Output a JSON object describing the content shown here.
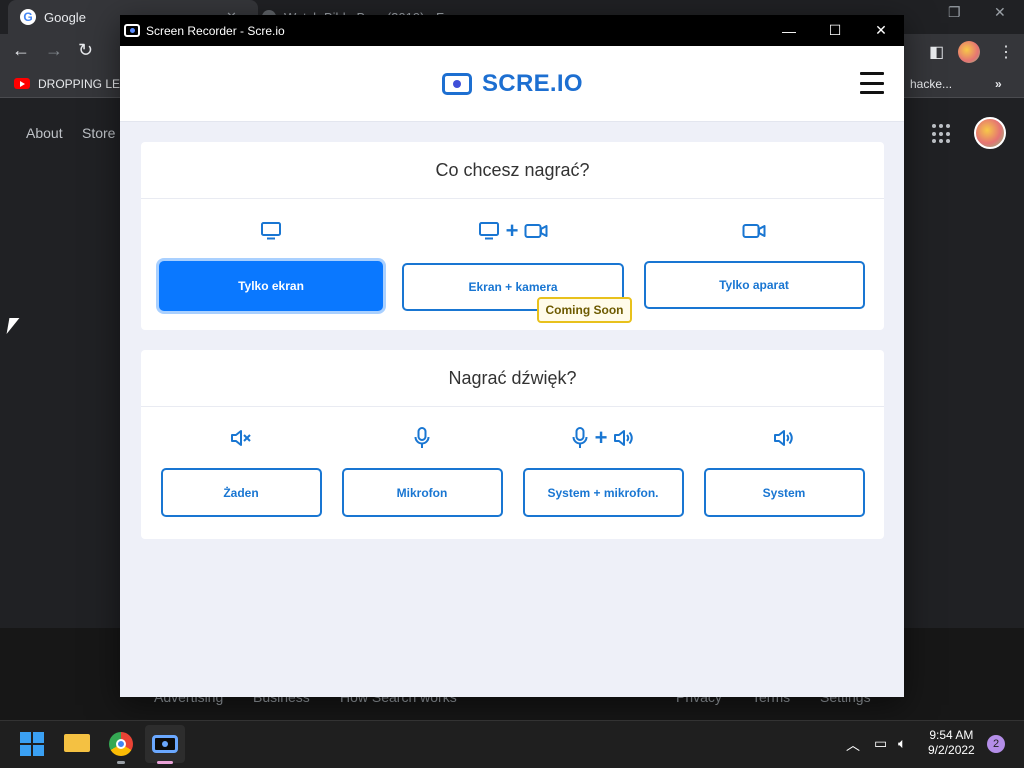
{
  "browser": {
    "active_tab_title": "Google",
    "inactive_tab_title": "Watch Bible Bros (2019) - Fre...",
    "bookmark_label": "DROPPING LEG",
    "bookmark_right": "hacke...",
    "nav_links": [
      "About",
      "Store"
    ],
    "footer_links": [
      "Advertising",
      "Business",
      "How Search works",
      "Privacy",
      "Terms",
      "Settings"
    ]
  },
  "recorder": {
    "window_title": "Screen Recorder - Scre.io",
    "logo_text": "SCRE.IO",
    "video_section": {
      "title": "Co chcesz nagrać?",
      "options": [
        {
          "label": "Tylko ekran",
          "icons": [
            "monitor-icon"
          ],
          "selected": true
        },
        {
          "label": "Ekran + kamera",
          "icons": [
            "monitor-icon",
            "plus-icon",
            "camera-icon"
          ],
          "selected": false
        },
        {
          "label": "Tylko aparat",
          "icons": [
            "camera-icon"
          ],
          "selected": false
        }
      ],
      "badge": "Coming Soon"
    },
    "audio_section": {
      "title": "Nagrać dźwięk?",
      "options": [
        {
          "label": "Żaden",
          "icons": [
            "mute-icon"
          ]
        },
        {
          "label": "Mikrofon",
          "icons": [
            "microphone-icon"
          ]
        },
        {
          "label": "System + mikrofon.",
          "icons": [
            "microphone-icon",
            "plus-icon",
            "speaker-icon"
          ]
        },
        {
          "label": "System",
          "icons": [
            "speaker-icon"
          ]
        }
      ]
    }
  },
  "taskbar": {
    "time": "9:54 AM",
    "date": "9/2/2022",
    "notifications": "2"
  },
  "colors": {
    "accent": "#1976d2",
    "selected": "#0a78ff",
    "badge_border": "#e8c11c"
  }
}
